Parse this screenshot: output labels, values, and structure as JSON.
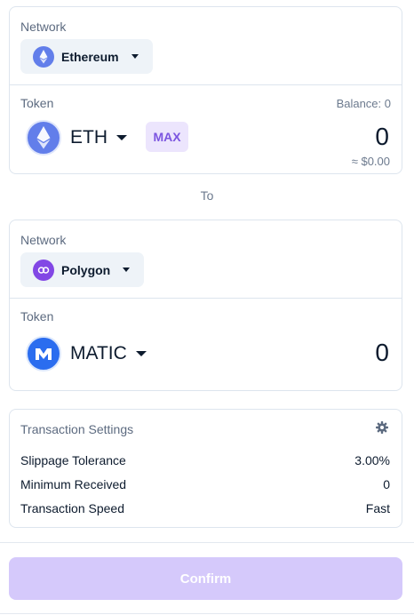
{
  "source": {
    "network_label": "Network",
    "network_name": "Ethereum",
    "token_label": "Token",
    "balance": "Balance: 0",
    "token_symbol": "ETH",
    "max_label": "MAX",
    "amount": "0",
    "fiat_value": "≈ $0.00"
  },
  "to_label": "To",
  "destination": {
    "network_label": "Network",
    "network_name": "Polygon",
    "token_label": "Token",
    "token_symbol": "MATIC",
    "amount": "0"
  },
  "settings": {
    "title": "Transaction Settings",
    "rows": [
      {
        "label": "Slippage Tolerance",
        "value": "3.00%"
      },
      {
        "label": "Minimum Received",
        "value": "0"
      },
      {
        "label": "Transaction Speed",
        "value": "Fast"
      }
    ]
  },
  "confirm_label": "Confirm",
  "colors": {
    "accent_purple": "#7b55e0",
    "confirm_disabled": "#d5c9fb",
    "ethereum_blue": "#627eea",
    "polygon_purple": "#8247e5",
    "matic_blue": "#2b6def"
  },
  "icons": {
    "source_network": "ethereum-icon",
    "source_token": "ethereum-icon",
    "dest_network": "polygon-icon",
    "dest_token": "matic-icon",
    "settings": "gear-icon"
  }
}
